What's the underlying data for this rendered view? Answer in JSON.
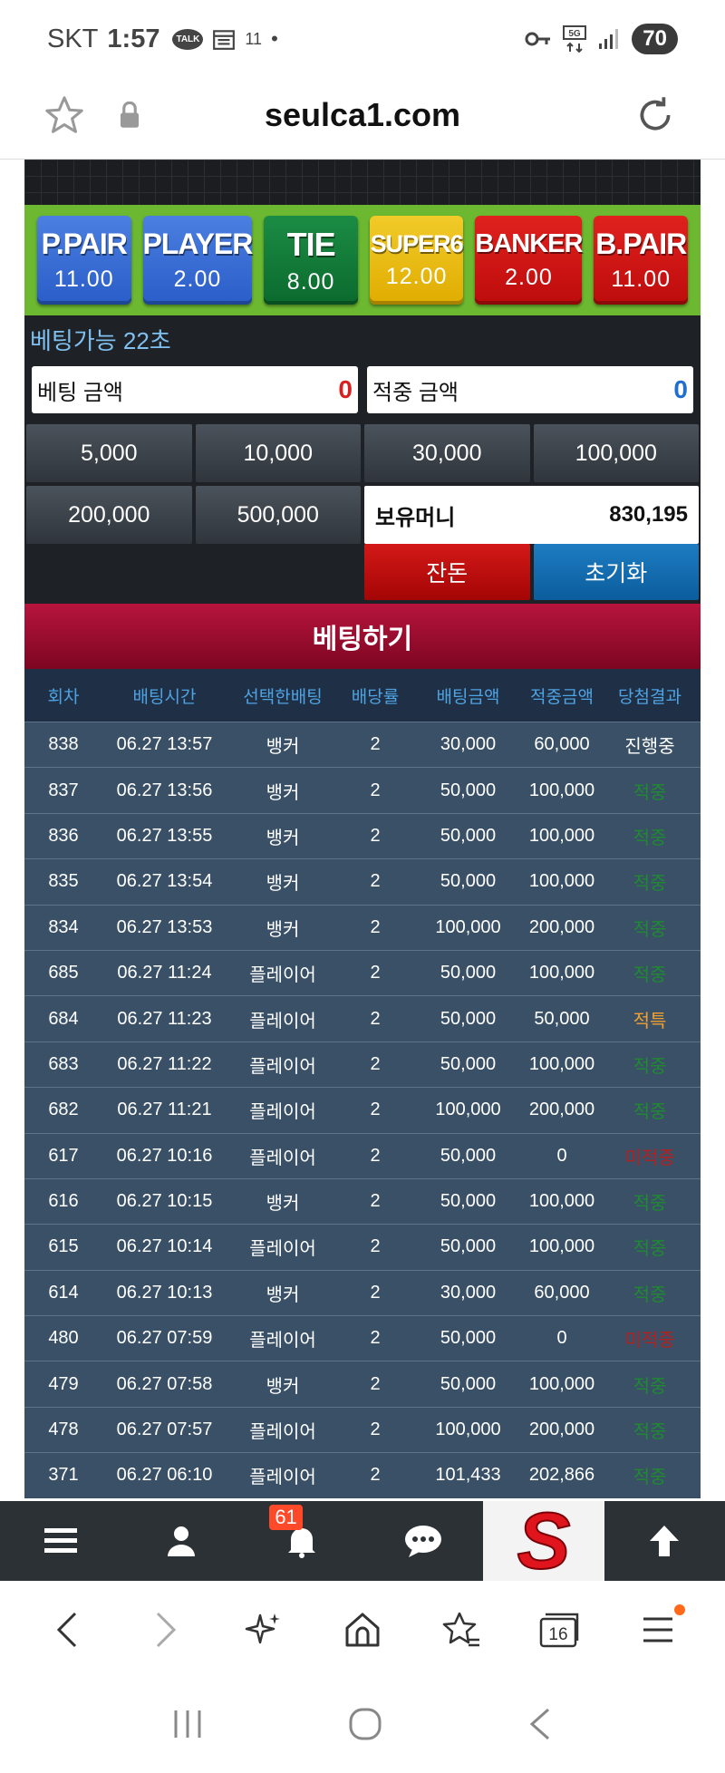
{
  "status_bar": {
    "carrier": "SKT",
    "time": "1:57",
    "talk_badge": "TALK",
    "notif_extra": "11",
    "battery": "70"
  },
  "browser": {
    "domain": "seulca1.com",
    "tab_count": "16"
  },
  "game": {
    "bets": [
      {
        "name": "P.PAIR",
        "odds": "11.00",
        "color": "#2f63cc"
      },
      {
        "name": "PLAYER",
        "odds": "2.00",
        "color": "#2f63cc"
      },
      {
        "name": "TIE",
        "odds": "8.00",
        "color": "#0f7335"
      },
      {
        "name": "SUPER6",
        "odds": "12.00",
        "color": "#eab814"
      },
      {
        "name": "BANKER",
        "odds": "2.00",
        "color": "#cc1515"
      },
      {
        "name": "B.PAIR",
        "odds": "11.00",
        "color": "#cc1515"
      }
    ],
    "countdown": "베팅가능 22초",
    "bet_amount_label": "베팅 금액",
    "bet_amount_value": "0",
    "win_amount_label": "적중 금액",
    "win_amount_value": "0",
    "chips": [
      "5,000",
      "10,000",
      "30,000",
      "100,000",
      "200,000",
      "500,000"
    ],
    "balance_label": "보유머니",
    "balance_value": "830,195",
    "change_button": "잔돈",
    "reset_button": "초기화",
    "place_bet_button": "베팅하기"
  },
  "history": {
    "headers": [
      "회차",
      "배팅시간",
      "선택한배팅",
      "배당률",
      "배팅금액",
      "적중금액",
      "당첨결과"
    ],
    "rows": [
      [
        "838",
        "06.27 13:57",
        "뱅커",
        "2",
        "30,000",
        "60,000",
        "진행중"
      ],
      [
        "837",
        "06.27 13:56",
        "뱅커",
        "2",
        "50,000",
        "100,000",
        "적중"
      ],
      [
        "836",
        "06.27 13:55",
        "뱅커",
        "2",
        "50,000",
        "100,000",
        "적중"
      ],
      [
        "835",
        "06.27 13:54",
        "뱅커",
        "2",
        "50,000",
        "100,000",
        "적중"
      ],
      [
        "834",
        "06.27 13:53",
        "뱅커",
        "2",
        "100,000",
        "200,000",
        "적중"
      ],
      [
        "685",
        "06.27 11:24",
        "플레이어",
        "2",
        "50,000",
        "100,000",
        "적중"
      ],
      [
        "684",
        "06.27 11:23",
        "플레이어",
        "2",
        "50,000",
        "50,000",
        "적특"
      ],
      [
        "683",
        "06.27 11:22",
        "플레이어",
        "2",
        "50,000",
        "100,000",
        "적중"
      ],
      [
        "682",
        "06.27 11:21",
        "플레이어",
        "2",
        "100,000",
        "200,000",
        "적중"
      ],
      [
        "617",
        "06.27 10:16",
        "플레이어",
        "2",
        "50,000",
        "0",
        "미적중"
      ],
      [
        "616",
        "06.27 10:15",
        "뱅커",
        "2",
        "50,000",
        "100,000",
        "적중"
      ],
      [
        "615",
        "06.27 10:14",
        "플레이어",
        "2",
        "50,000",
        "100,000",
        "적중"
      ],
      [
        "614",
        "06.27 10:13",
        "뱅커",
        "2",
        "30,000",
        "60,000",
        "적중"
      ],
      [
        "480",
        "06.27 07:59",
        "플레이어",
        "2",
        "50,000",
        "0",
        "미적중"
      ],
      [
        "479",
        "06.27 07:58",
        "뱅커",
        "2",
        "50,000",
        "100,000",
        "적중"
      ],
      [
        "478",
        "06.27 07:57",
        "플레이어",
        "2",
        "100,000",
        "200,000",
        "적중"
      ],
      [
        "371",
        "06.27 06:10",
        "플레이어",
        "2",
        "101,433",
        "202,866",
        "적중"
      ]
    ]
  },
  "site_nav": {
    "notification_count": "61",
    "logo_letter": "S"
  }
}
